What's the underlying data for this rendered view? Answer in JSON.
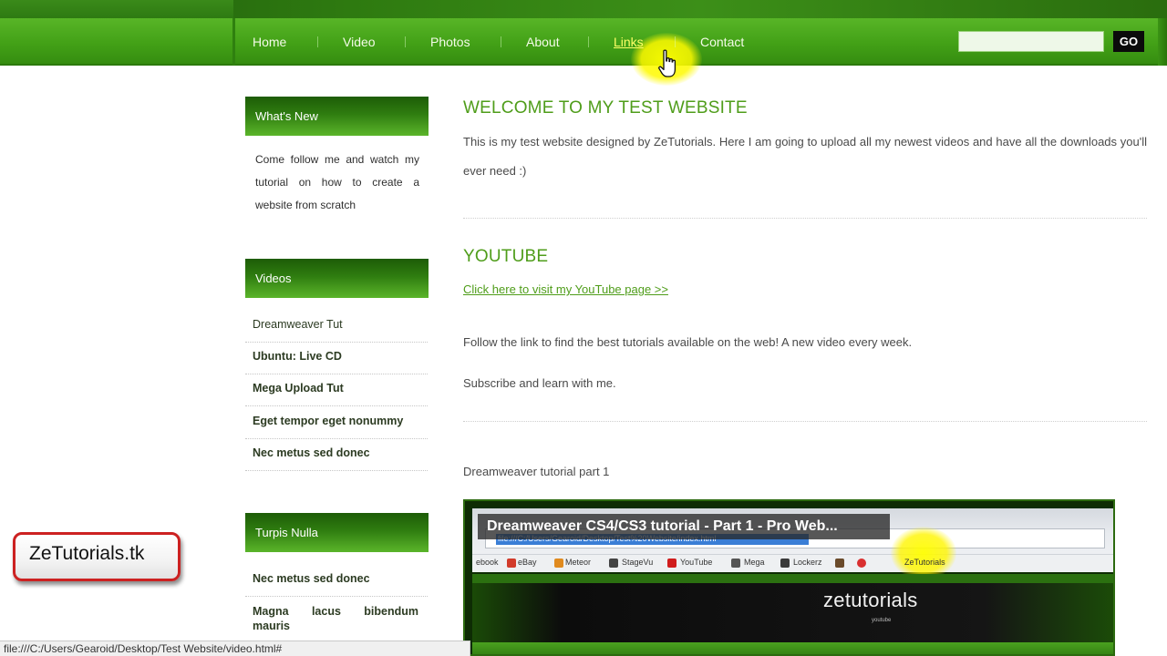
{
  "nav": {
    "items": [
      {
        "label": "Home"
      },
      {
        "label": "Video"
      },
      {
        "label": "Photos"
      },
      {
        "label": "About"
      },
      {
        "label": "Links",
        "active": true
      },
      {
        "label": "Contact"
      }
    ],
    "search_value": "",
    "go_label": "GO"
  },
  "sidebar": {
    "whats_new": {
      "title": "What's New",
      "text": "Come follow me and watch my tutorial on how to create a website from scratch"
    },
    "videos": {
      "title": "Videos",
      "items": [
        "Dreamweaver Tut",
        "Ubuntu: Live CD",
        "Mega Upload Tut",
        "Eget tempor eget nonummy",
        "Nec metus sed donec"
      ]
    },
    "turpis": {
      "title": "Turpis Nulla",
      "items": [
        "Nec metus sed donec",
        "Magna lacus bibendum mauris"
      ]
    }
  },
  "main": {
    "welcome_heading": "WELCOME TO MY TEST WEBSITE",
    "welcome_text": "This is my test website designed by ZeTutorials. Here I am going to upload all my newest videos and have all the downloads you'll ever need :)",
    "youtube_heading": "YOUTUBE",
    "youtube_link": "Click here to visit my YouTube page >>",
    "youtube_text1": "Follow the link to find the best tutorials available on the web! A new video every week.",
    "youtube_text2": "Subscribe and learn with me.",
    "video_caption": "Dreamweaver tutorial part 1"
  },
  "video": {
    "title": "Dreamweaver CS4/CS3 tutorial - Part 1 - Pro Web...",
    "url": "file:///C:/Users/Gearoid/Desktop/Test%20Website/index.html",
    "bookmarks": [
      "ebook",
      "eBay",
      "Meteor",
      "StageVu",
      "YouTube",
      "Mega",
      "Lockerz",
      "ZeTutorials"
    ],
    "site_logo": "zetutorials",
    "site_logo_sub": "youtube"
  },
  "badge": {
    "text": "ZeTutorials.tk"
  },
  "status_bar": {
    "text": "file:///C:/Users/Gearoid/Desktop/Test Website/video.html#"
  },
  "colors": {
    "nav_green": "#43a117",
    "heading_green": "#4f9d1a",
    "badge_border": "#cc2121",
    "highlight_yellow": "#ffff00"
  },
  "icons": {
    "cursor": "hand-pointer-icon"
  }
}
